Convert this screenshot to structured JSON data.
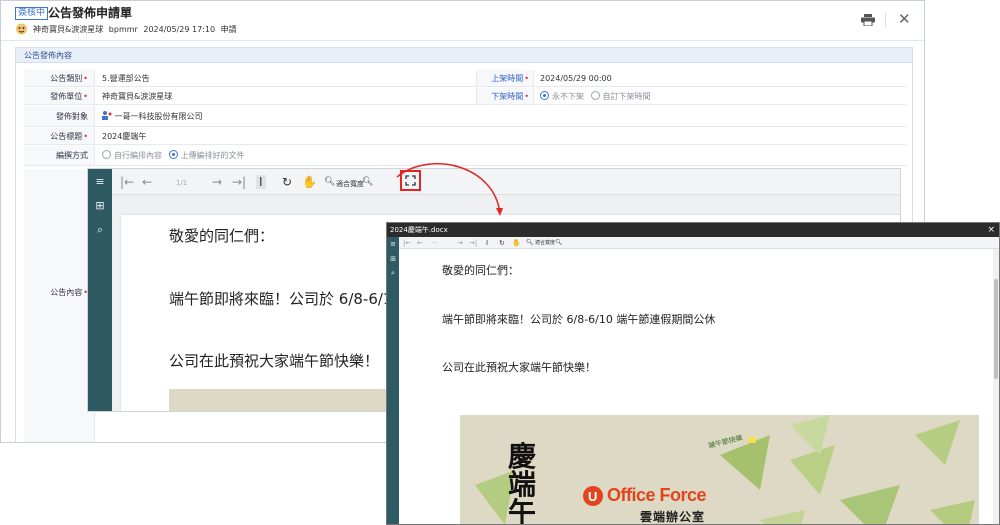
{
  "app": {
    "status_badge": "簽核中",
    "form_title": "公告發佈申請單",
    "meta": {
      "dept": "神奇寶貝&淚淚星球",
      "user": "bpmmr",
      "datetime": "2024/05/29 17:10",
      "suffix": "申請"
    }
  },
  "section_title": "公告發佈內容",
  "fields": {
    "category": {
      "label": "公告類別",
      "value": "5.營運部公告"
    },
    "publish_unit": {
      "label": "發佈單位",
      "value": "神奇寶貝&淚淚星球"
    },
    "audience": {
      "label": "發佈對象",
      "value": "一哥一科技股份有限公司"
    },
    "subject": {
      "label": "公告標題",
      "value": "2024慶端午"
    },
    "layout": {
      "label": "編撰方式",
      "option1": "自行編排內容",
      "option2": "上傳編排好的文件"
    },
    "content": {
      "label": "公告內容"
    },
    "start_time": {
      "label": "上架時間",
      "value": "2024/05/29 00:00"
    },
    "end_time": {
      "label": "下架時間",
      "option1": "永不下架",
      "option2": "自訂下架時間"
    }
  },
  "viewer": {
    "page_indicator": "1/1",
    "fit_label": "適合寬度",
    "line1": "敬愛的同仁們：",
    "line2": "端午節即將來臨！公司於 6/8-6/1",
    "line3": "公司在此預祝大家端午節快樂！"
  },
  "popup": {
    "title": "2024慶端午.docx",
    "close": "×",
    "fit_label": "適合寬度",
    "line1": "敬愛的同仁們：",
    "line2": "端午節即將來臨！公司於 6/8-6/10 端午節連假期間公休",
    "line3": "公司在此預祝大家端午節快樂！",
    "banner": {
      "calligraphy": [
        "慶",
        "端",
        "午"
      ],
      "brand": "Office Force",
      "brand_sub": "雲端辦公室",
      "tag": "端午節快樂"
    }
  },
  "colors": {
    "accent": "#3d73d3",
    "required": "#e0302b",
    "viewer_sidebar": "#2e5a63",
    "highlight": "#e52421",
    "brand": "#e2451d"
  }
}
